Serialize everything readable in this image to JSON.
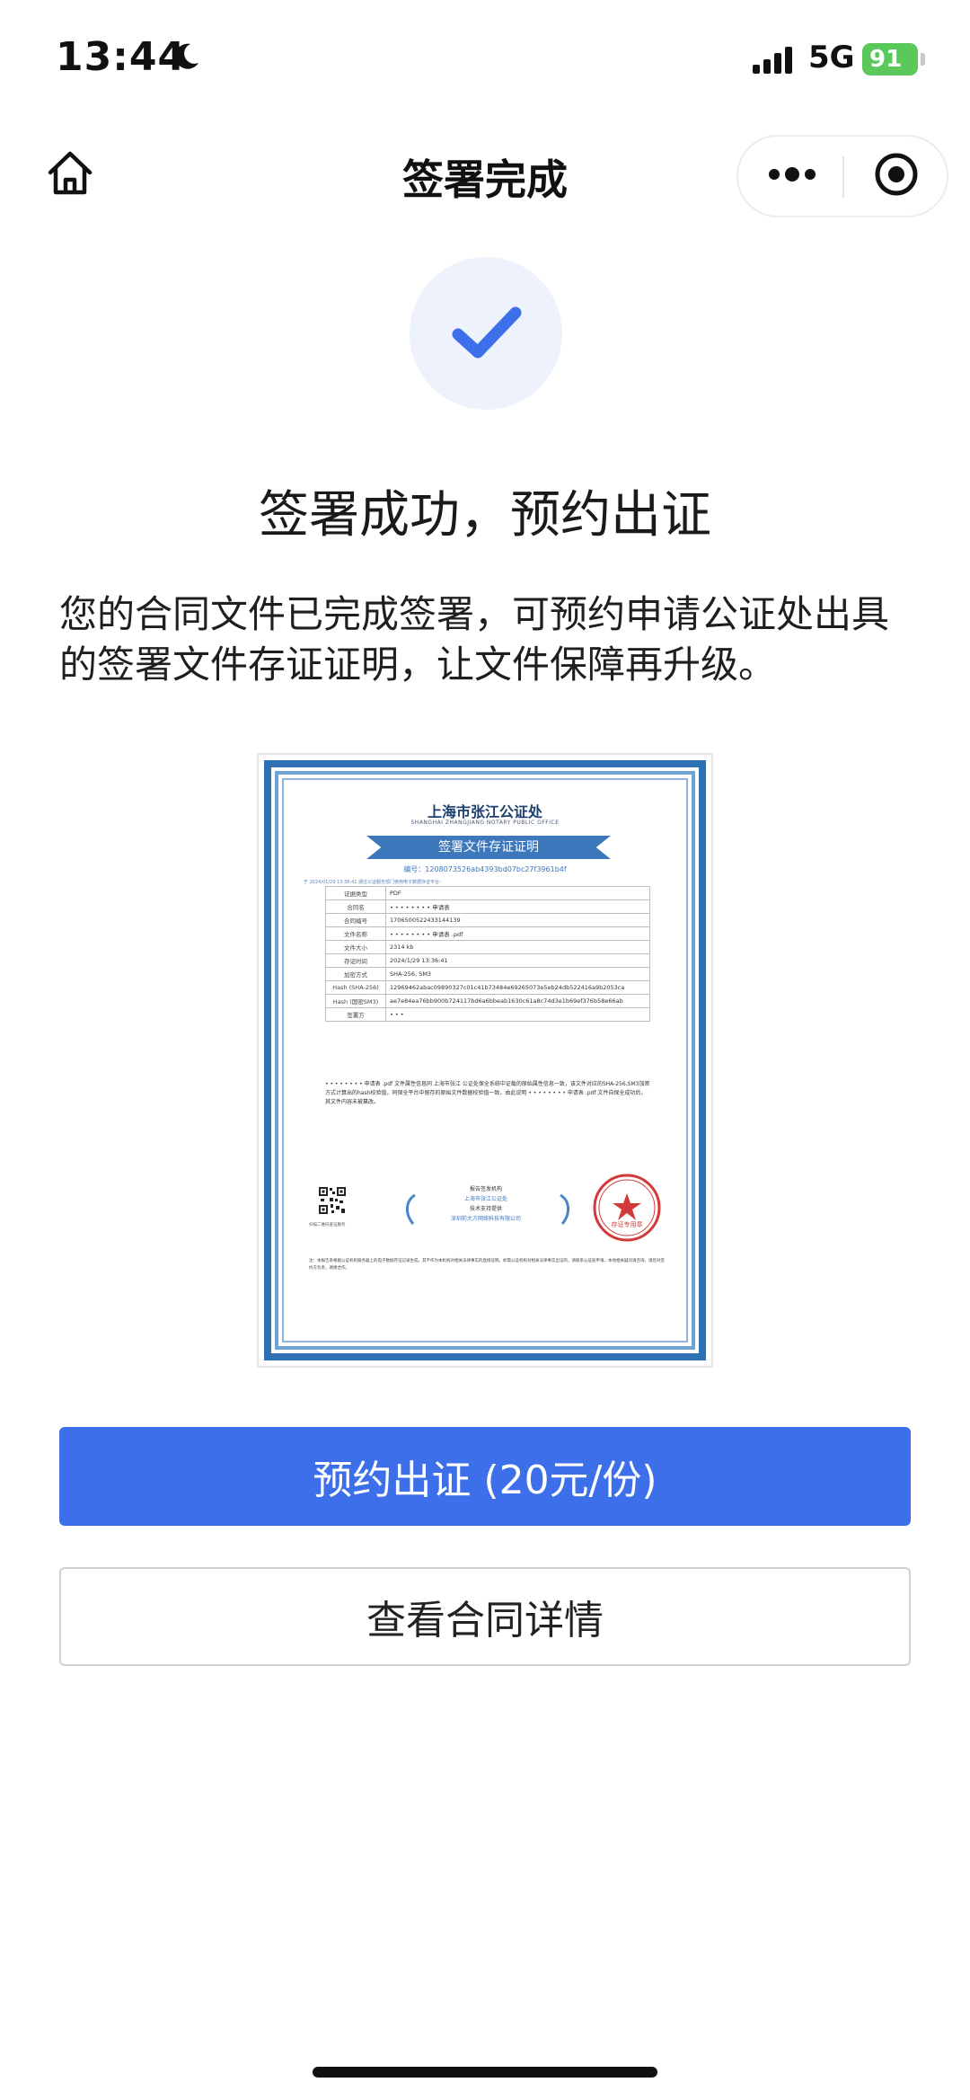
{
  "status_bar": {
    "time": "13:44",
    "network": "5G",
    "battery": "91"
  },
  "nav": {
    "title": "签署完成"
  },
  "result": {
    "headline": "签署成功，预约出证",
    "description": "您的合同文件已完成签署，可预约申请公证处出具的签署文件存证证明，让文件保障再升级。"
  },
  "certificate": {
    "org_name": "上海市张江公证处",
    "org_name_en": "SHANGHAI ZHANGJIANG NOTARY PUBLIC OFFICE",
    "title": "签署文件存证证明",
    "number": "编号：1208073526ab4393bd07bc27f3961b4f",
    "note": "于 2024/01/29 13:36:41 通过公证服务部门使用电子数据存证平台：",
    "rows": [
      {
        "key": "证据类型",
        "value": "PDF"
      },
      {
        "key": "合同名",
        "value": "• • • • • • • • 申请表"
      },
      {
        "key": "合同编号",
        "value": "1706500522433144139"
      },
      {
        "key": "文件名称",
        "value": "• • • • • • • • 申请表 .pdf"
      },
      {
        "key": "文件大小",
        "value": "2314 kb"
      },
      {
        "key": "存证时间",
        "value": "2024/1/29 13:36:41"
      },
      {
        "key": "加密方式",
        "value": "SHA-256, SM3"
      },
      {
        "key": "Hash (SHA-256)",
        "value": "12969462abac09890327c01c41b73484e69265073e5eb24db522416a9b2053ca"
      },
      {
        "key": "Hash (国密SM3)",
        "value": "ae7e84ea76bb900b724117bd6a6bbeab1630c61a8c74d3e1b69ef376b58e66ab"
      },
      {
        "key": "签署方",
        "value": "• • •"
      }
    ],
    "body_text": "• • • • • • • • 申请表 .pdf 文件属性信息同 上海市张江 公证处保全系统中证载的原始属性信息一致，该文件对应的SHA-256,SM3加密方式计算出的hash校验值，同保全平台中留存的原始文件数据校验值一致，由此说明 • • • • • • • • 申请表 .pdf 文件自保全成功后，其文件内容未被篡改。",
    "qr_caption": "扫描二维码查证服务",
    "issuer_label": "报告签发机构",
    "issuer_name": "上海市张江公证处",
    "tech_label": "技术支持提供",
    "tech_name": "深圳前大方网络科技有限公司",
    "seal_text": "存证专用章",
    "footer_text": "注：本报告系根据公证机构服务器上的电子数据存证记录生成，其不作为本机构对相关法律事实的直接证明。如需公证机构对相关法律事实出证的，请联系公证处申请。本地相关疑问请咨询，请您对签约方负责，谢谢合作。"
  },
  "actions": {
    "primary_label": "预约出证 (20元/份)",
    "secondary_label": "查看合同详情"
  },
  "colors": {
    "primary": "#3e6fea",
    "success_bg": "#edf2fc",
    "cert_border": "#2f6fb3",
    "seal": "#d23a3a"
  }
}
